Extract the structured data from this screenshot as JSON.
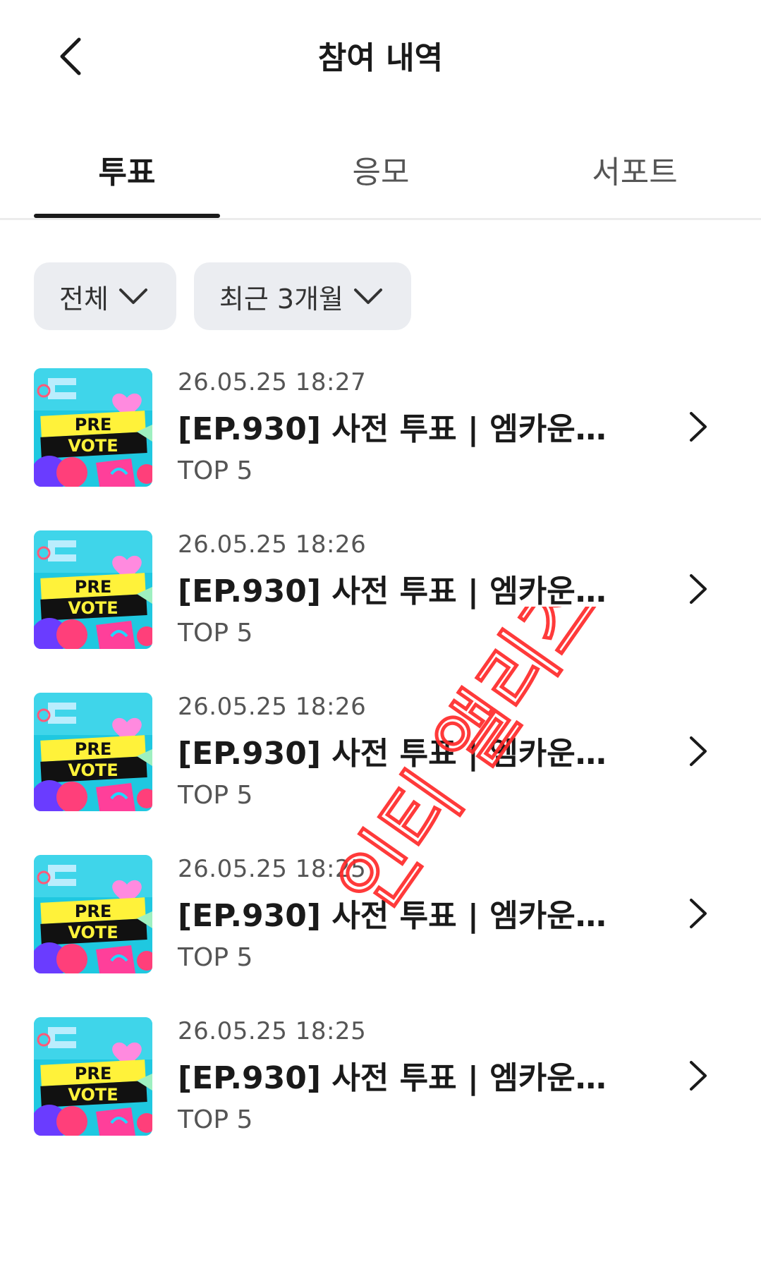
{
  "header": {
    "title": "참여 내역",
    "back_icon": "chevron-left-icon"
  },
  "tabs": [
    {
      "label": "투표",
      "active": true
    },
    {
      "label": "응모",
      "active": false
    },
    {
      "label": "서포트",
      "active": false
    }
  ],
  "filters": [
    {
      "label": "전체",
      "icon": "chevron-down-icon"
    },
    {
      "label": "최근 3개월",
      "icon": "chevron-down-icon"
    }
  ],
  "items": [
    {
      "date": "26.05.25 18:27",
      "title": "[EP.930] 사전 투표 | 엠카운트...",
      "subtitle": "TOP 5",
      "thumb_line1": "PRE",
      "thumb_line2": "VOTE"
    },
    {
      "date": "26.05.25 18:26",
      "title": "[EP.930] 사전 투표 | 엠카운트...",
      "subtitle": "TOP 5",
      "thumb_line1": "PRE",
      "thumb_line2": "VOTE"
    },
    {
      "date": "26.05.25 18:26",
      "title": "[EP.930] 사전 투표 | 엠카운트...",
      "subtitle": "TOP 5",
      "thumb_line1": "PRE",
      "thumb_line2": "VOTE"
    },
    {
      "date": "26.05.25 18:25",
      "title": "[EP.930] 사전 투표 | 엠카운트...",
      "subtitle": "TOP 5",
      "thumb_line1": "PRE",
      "thumb_line2": "VOTE"
    },
    {
      "date": "26.05.25 18:25",
      "title": "[EP.930] 사전 투표 | 엠카운트...",
      "subtitle": "TOP 5",
      "thumb_line1": "PRE",
      "thumb_line2": "VOTE"
    }
  ],
  "watermark": {
    "text": "인티 앨리즈",
    "color": "#ff2a2a"
  },
  "colors": {
    "tab_active": "#1a1a1a",
    "filter_bg": "#ebedf1",
    "thumb_bg": "#1fc8e0",
    "thumb_yellow": "#fff23a"
  }
}
